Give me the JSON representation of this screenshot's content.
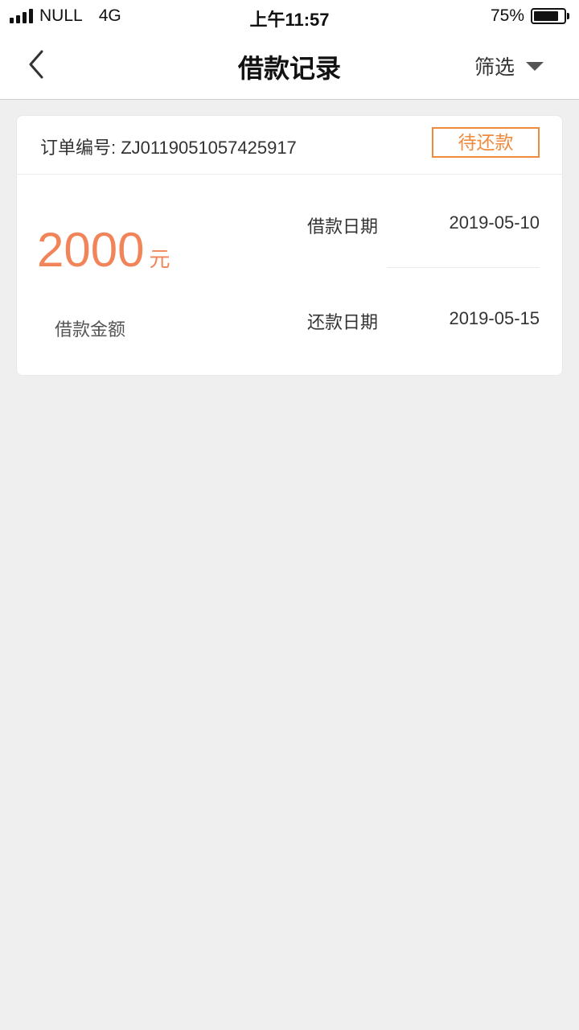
{
  "status_bar": {
    "carrier": "NULL",
    "network": "4G",
    "time": "上午11:57",
    "battery": "75%"
  },
  "nav": {
    "title": "借款记录",
    "filter_label": "筛选"
  },
  "loan": {
    "order_number": "订单编号: ZJ0119051057425917",
    "status": "待还款",
    "amount": "2000",
    "amount_unit": "元",
    "amount_label": "借款金额",
    "borrow_date_label": "借款日期",
    "borrow_date": "2019-05-10",
    "repay_date_label": "还款日期",
    "repay_date": "2019-05-15"
  },
  "colors": {
    "accent": "#f08a3c",
    "amount": "#f2845a",
    "background": "#efefef"
  }
}
